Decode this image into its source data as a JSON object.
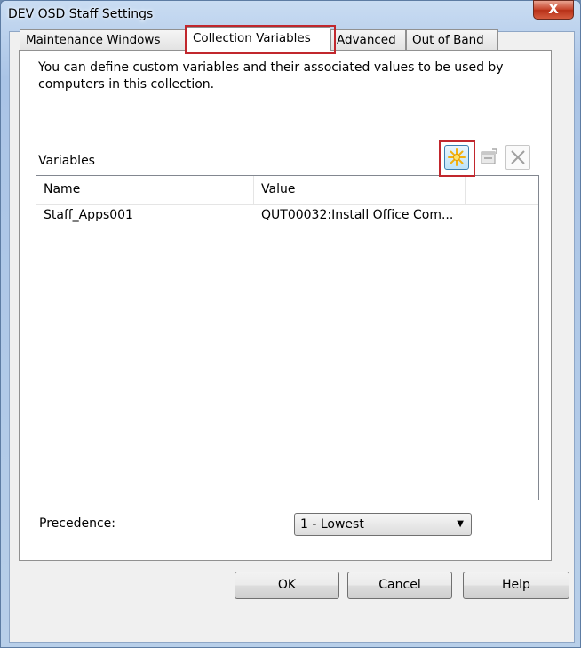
{
  "window": {
    "title": "DEV OSD Staff Settings",
    "close_glyph": "X"
  },
  "tabs": [
    {
      "label": "Maintenance Windows"
    },
    {
      "label": "Collection Variables",
      "active": true
    },
    {
      "label": "Advanced"
    },
    {
      "label": "Out of Band"
    }
  ],
  "panel": {
    "description": "You can define custom variables and their associated values to be used by computers in this collection.",
    "variables_label": "Variables",
    "toolbar": {
      "new_icon": "starburst-new-icon",
      "properties_icon": "properties-icon",
      "delete_icon": "delete-x-icon"
    },
    "list": {
      "columns": [
        "Name",
        "Value"
      ],
      "rows": [
        {
          "name": "Staff_Apps001",
          "value": "QUT00032:Install Office Com..."
        }
      ]
    },
    "precedence_label": "Precedence:",
    "precedence_value": "1 - Lowest"
  },
  "buttons": {
    "ok": "OK",
    "cancel": "Cancel",
    "help": "Help"
  },
  "colors": {
    "highlight": "#c1272d",
    "accent": "#3c7fb1"
  }
}
